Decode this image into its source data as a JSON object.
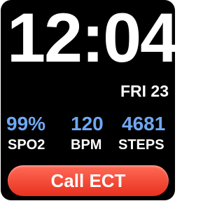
{
  "clock": {
    "time": "12:04",
    "date": "FRI 23"
  },
  "stats": [
    {
      "value": "99%",
      "label": "SPO2"
    },
    {
      "value": "120",
      "label": "BPM"
    },
    {
      "value": "4681",
      "label": "STEPS"
    }
  ],
  "action": {
    "call_label": "Call ECT"
  },
  "colors": {
    "background": "#000000",
    "text": "#ffffff",
    "stat_accent": "#6fa8f2",
    "button_top": "#ff6b57",
    "button_bottom": "#e8311e"
  }
}
